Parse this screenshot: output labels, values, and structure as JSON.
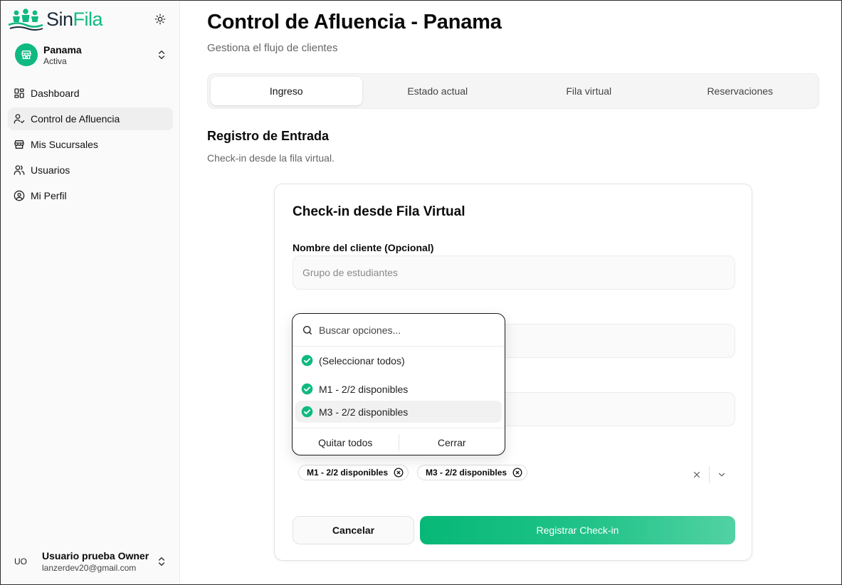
{
  "brand": {
    "name_a": "Sin",
    "name_b": "Fila",
    "accent": "#10b981"
  },
  "sidebar": {
    "branch": {
      "name": "Panama",
      "status": "Activa"
    },
    "items": [
      {
        "label": "Dashboard",
        "icon": "dashboard-icon"
      },
      {
        "label": "Control de Afluencia",
        "icon": "user-check-icon"
      },
      {
        "label": "Mis Sucursales",
        "icon": "store-icon"
      },
      {
        "label": "Usuarios",
        "icon": "users-icon"
      },
      {
        "label": "Mi Perfil",
        "icon": "user-circle-icon"
      }
    ],
    "active_item": "Control de Afluencia",
    "user": {
      "initials": "UO",
      "name": "Usuario prueba Owner",
      "email": "lanzerdev20@gmail.com"
    }
  },
  "header": {
    "title": "Control de Afluencia - Panama",
    "subtitle": "Gestiona el flujo de clientes"
  },
  "tabs": [
    {
      "label": "Ingreso"
    },
    {
      "label": "Estado actual"
    },
    {
      "label": "Fila virtual"
    },
    {
      "label": "Reservaciones"
    }
  ],
  "active_tab": "Ingreso",
  "section": {
    "title": "Registro de Entrada",
    "subtitle": "Check-in desde la fila virtual."
  },
  "form": {
    "title": "Check-in desde Fila Virtual",
    "name_label": "Nombre del cliente (Opcional)",
    "name_placeholder": "Grupo de estudiantes",
    "selected_chips": [
      "M1 - 2/2 disponibles",
      "M3 - 2/2 disponibles"
    ],
    "cancel_label": "Cancelar",
    "submit_label": "Registrar Check-in"
  },
  "dropdown": {
    "search_placeholder": "Buscar opciones...",
    "options": [
      {
        "label": "(Seleccionar todos)",
        "checked": true
      },
      {
        "label": "M1 - 2/2 disponibles",
        "checked": true
      },
      {
        "label": "M3 - 2/2 disponibles",
        "checked": true,
        "highlighted": true
      }
    ],
    "clear_label": "Quitar todos",
    "close_label": "Cerrar"
  }
}
